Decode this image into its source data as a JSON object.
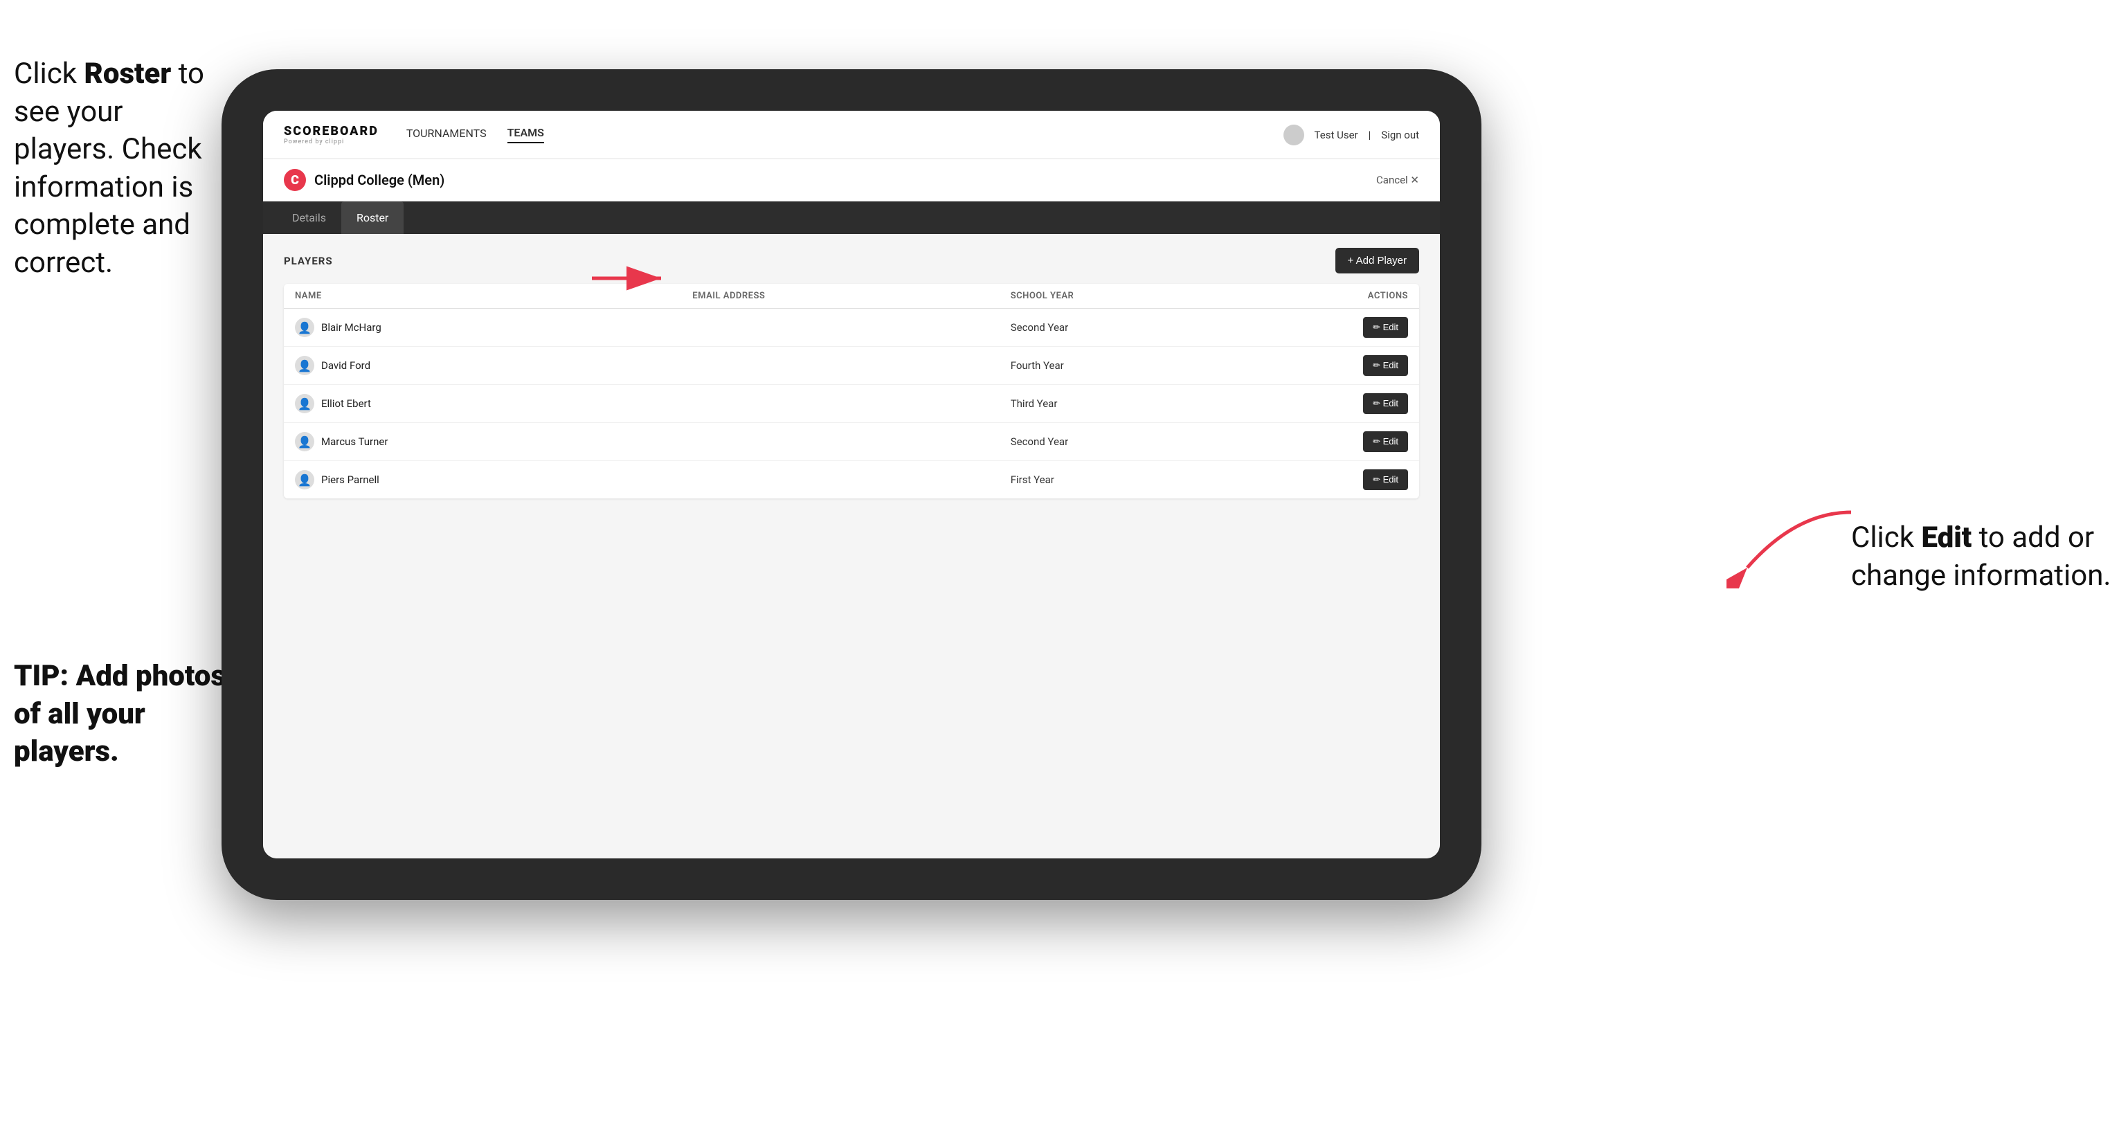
{
  "instructions": {
    "main_text_part1": "Click ",
    "main_bold": "Roster",
    "main_text_part2": " to see your players. Check information is complete and correct.",
    "tip": "TIP: Add photos of all your players.",
    "right_part1": "Click ",
    "right_bold": "Edit",
    "right_part2": " to add or change information."
  },
  "navbar": {
    "logo": "SCOREBOARD",
    "logo_sub": "Powered by clippi",
    "links": [
      "TOURNAMENTS",
      "TEAMS"
    ],
    "active_link": "TEAMS",
    "user_label": "Test User",
    "signout_label": "Sign out"
  },
  "team": {
    "logo_letter": "C",
    "name": "Clippd College (Men)",
    "cancel_label": "Cancel ✕"
  },
  "tabs": [
    {
      "label": "Details",
      "active": false
    },
    {
      "label": "Roster",
      "active": true
    }
  ],
  "players_section": {
    "label": "PLAYERS",
    "add_button": "+ Add Player"
  },
  "table": {
    "columns": [
      "NAME",
      "EMAIL ADDRESS",
      "SCHOOL YEAR",
      "ACTIONS"
    ],
    "rows": [
      {
        "name": "Blair McHarg",
        "email": "",
        "school_year": "Second Year",
        "action": "Edit"
      },
      {
        "name": "David Ford",
        "email": "",
        "school_year": "Fourth Year",
        "action": "Edit"
      },
      {
        "name": "Elliot Ebert",
        "email": "",
        "school_year": "Third Year",
        "action": "Edit"
      },
      {
        "name": "Marcus Turner",
        "email": "",
        "school_year": "Second Year",
        "action": "Edit"
      },
      {
        "name": "Piers Parnell",
        "email": "",
        "school_year": "First Year",
        "action": "Edit"
      }
    ]
  },
  "colors": {
    "accent_red": "#e8374c",
    "dark": "#2d2d2d",
    "edit_btn_bg": "#2d2d2d"
  }
}
